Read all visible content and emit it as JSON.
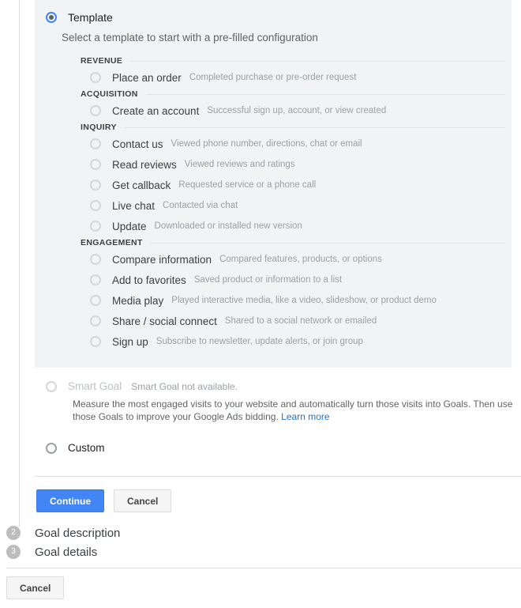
{
  "template": {
    "label": "Template",
    "subtitle": "Select a template to start with a pre-filled configuration",
    "selected": true,
    "groups": [
      {
        "title": "REVENUE",
        "options": [
          {
            "label": "Place an order",
            "desc": "Completed purchase or pre-order request"
          }
        ]
      },
      {
        "title": "ACQUISITION",
        "options": [
          {
            "label": "Create an account",
            "desc": "Successful sign up, account, or view created"
          }
        ]
      },
      {
        "title": "INQUIRY",
        "options": [
          {
            "label": "Contact us",
            "desc": "Viewed phone number, directions, chat or email"
          },
          {
            "label": "Read reviews",
            "desc": "Viewed reviews and ratings"
          },
          {
            "label": "Get callback",
            "desc": "Requested service or a phone call"
          },
          {
            "label": "Live chat",
            "desc": "Contacted via chat"
          },
          {
            "label": "Update",
            "desc": "Downloaded or installed new version"
          }
        ]
      },
      {
        "title": "ENGAGEMENT",
        "options": [
          {
            "label": "Compare information",
            "desc": "Compared features, products, or options"
          },
          {
            "label": "Add to favorites",
            "desc": "Saved product or information to a list"
          },
          {
            "label": "Media play",
            "desc": "Played interactive media, like a video, slideshow, or product demo"
          },
          {
            "label": "Share / social connect",
            "desc": "Shared to a social network or emailed"
          },
          {
            "label": "Sign up",
            "desc": "Subscribe to newsletter, update alerts, or join group"
          }
        ]
      }
    ]
  },
  "smart_goal": {
    "label": "Smart Goal",
    "note": "Smart Goal not available.",
    "body": "Measure the most engaged visits to your website and automatically turn those visits into Goals. Then use those Goals to improve your Google Ads bidding.",
    "link_text": "Learn more"
  },
  "custom": {
    "label": "Custom"
  },
  "actions": {
    "continue_label": "Continue",
    "cancel_label": "Cancel"
  },
  "steps": [
    {
      "number": "2",
      "title": "Goal description"
    },
    {
      "number": "3",
      "title": "Goal details"
    }
  ],
  "footer": {
    "cancel_label": "Cancel"
  },
  "colors": {
    "accent": "#4285f4",
    "link": "#1a73e8",
    "panel_bg": "#f1f3f4",
    "muted_text": "#9aa0a6"
  }
}
